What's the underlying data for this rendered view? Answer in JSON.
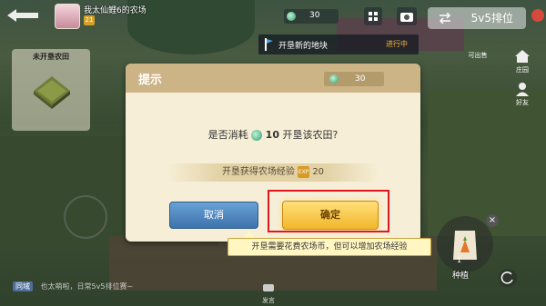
{
  "topbar": {
    "farm_name": "我太仙鲤6的农场",
    "level": "21",
    "coins": "30",
    "mode_button": "5v5排位"
  },
  "left_card": {
    "title": "未开垦农田"
  },
  "quest": {
    "title": "开垦新的地块",
    "status": "进行中"
  },
  "side_buttons": [
    "可出售",
    "庄园",
    "好友"
  ],
  "seed": {
    "count": "1",
    "label": "种植"
  },
  "chat": {
    "channel": "同域",
    "message": "也太萌啦，日常5v5排位赛~"
  },
  "send_label": "发言",
  "dialog": {
    "title": "提示",
    "balance": "30",
    "question_prefix": "是否消耗",
    "question_cost": "10",
    "question_suffix": "开垦该农田?",
    "reward_text": "开垦获得农场经验",
    "reward_amount": "20",
    "cancel_label": "取消",
    "confirm_label": "确定"
  },
  "tooltip": {
    "text": "开垦需要花费农场币，但可以增加农场经验"
  },
  "colors": {
    "highlight": "#e0171e",
    "confirm": "#f1b72a",
    "cancel": "#3e72ab",
    "header": "#ccb486"
  }
}
